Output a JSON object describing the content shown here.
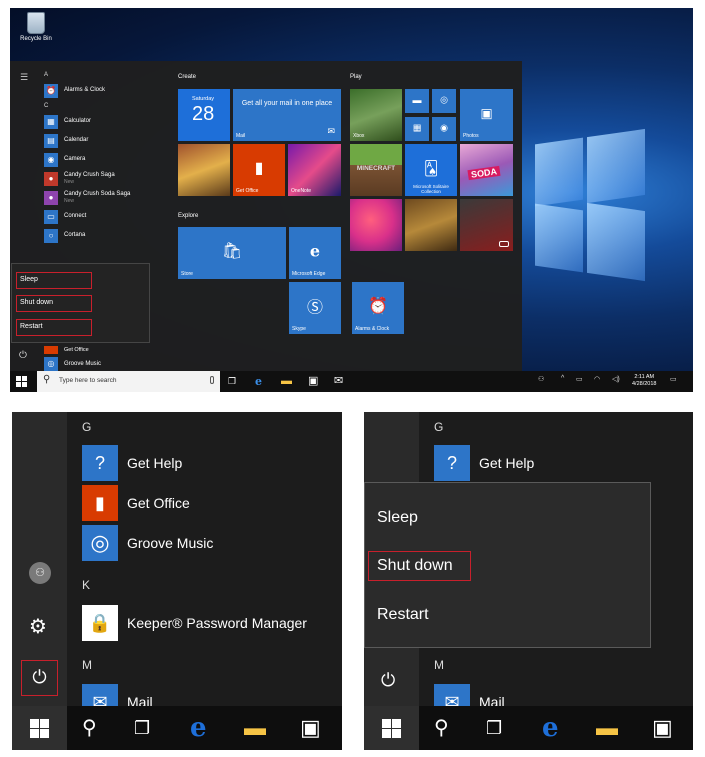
{
  "desktop": {
    "recycle_bin": "Recycle Bin",
    "start_list": [
      {
        "type": "letter",
        "text": "A"
      },
      {
        "type": "app",
        "label": "Alarms & Clock",
        "icon": "alarm-icon",
        "color": "#2d75c8"
      },
      {
        "type": "letter",
        "text": "C"
      },
      {
        "type": "app",
        "label": "Calculator",
        "icon": "calculator-icon",
        "color": "#2d75c8"
      },
      {
        "type": "app",
        "label": "Calendar",
        "icon": "calendar-icon",
        "color": "#2d75c8"
      },
      {
        "type": "app",
        "label": "Camera",
        "icon": "camera-icon",
        "color": "#2d75c8"
      },
      {
        "type": "app",
        "label": "Candy Crush Saga",
        "sub": "New",
        "icon": "candy-crush-icon",
        "color": "#c0392b"
      },
      {
        "type": "app",
        "label": "Candy Crush Soda Saga",
        "sub": "New",
        "icon": "candy-soda-icon",
        "color": "#8e44ad"
      },
      {
        "type": "app",
        "label": "Connect",
        "icon": "connect-icon",
        "color": "#2d75c8"
      },
      {
        "type": "app",
        "label": "Cortana",
        "icon": "cortana-icon",
        "color": "#2d75c8"
      }
    ],
    "groups": {
      "create": "Create",
      "play": "Play",
      "explore": "Explore"
    },
    "tiles": {
      "calendar_day": "Saturday",
      "calendar_date": "28",
      "mail_text": "Get all your mail in one place",
      "mail_label": "Mail",
      "get_office": "Get Office",
      "onenote": "OneNote",
      "xbox": "Xbox",
      "photos": "Photos",
      "minecraft": "MINECRAFT",
      "solitaire": "Microsoft Solitaire Collection",
      "soda": "SODA",
      "store": "Store",
      "edge": "Microsoft Edge",
      "skype": "Skype",
      "alarms": "Alarms & Clock"
    },
    "power_menu": [
      "Sleep",
      "Shut down",
      "Restart"
    ],
    "groove": "Groove Music",
    "get_office_partial": "Get Office",
    "search_placeholder": "Type here to search",
    "clock_time": "2:11 AM",
    "clock_date": "4/28/2018"
  },
  "start_zoom": {
    "letters": [
      "G",
      "K",
      "M"
    ],
    "apps": [
      {
        "label": "Get Help",
        "icon": "help-icon",
        "color": "#2d75c8"
      },
      {
        "label": "Get Office",
        "icon": "office-icon",
        "color": "#d83b01"
      },
      {
        "label": "Groove Music",
        "icon": "groove-icon",
        "color": "#2d75c8"
      },
      {
        "label": "Keeper® Password Manager",
        "icon": "keeper-lock-icon",
        "color": "#ffffff"
      },
      {
        "label": "Mail",
        "icon": "mail-icon",
        "color": "#2d75c8"
      }
    ]
  },
  "power_zoom": {
    "letters": [
      "G",
      "M"
    ],
    "get_help": "Get Help",
    "mail": "Mail",
    "menu": [
      "Sleep",
      "Shut down",
      "Restart"
    ]
  },
  "colors": {
    "accent": "#2d75c8",
    "highlight_border": "#c8202c",
    "office": "#d83b01",
    "edge_blue": "#1e6fd9",
    "folder": "#f6c445"
  }
}
